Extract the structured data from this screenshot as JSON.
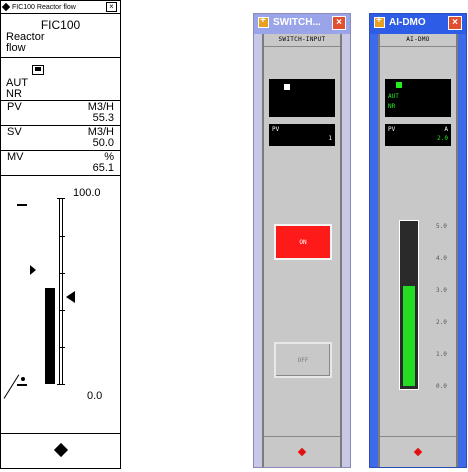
{
  "faceplate": {
    "title": "FIC100 Reactor flow",
    "close_glyph": "×",
    "tag": "FIC100",
    "comment_line1": "Reactor",
    "comment_line2": "flow",
    "mode": "AUT",
    "status": "NR",
    "pv": {
      "label": "PV",
      "unit": "M3/H",
      "value": "55.3"
    },
    "sv": {
      "label": "SV",
      "unit": "M3/H",
      "value": "50.0"
    },
    "mv": {
      "label": "MV",
      "unit": "%",
      "value": "65.1"
    },
    "scale_high": "100.0",
    "scale_low": "0.0"
  },
  "switch_window": {
    "title": "SWITCH...",
    "close_glyph": "×",
    "header": "SWITCH-INPUT",
    "pv_label": "PV",
    "pv_value": "1",
    "on_label": "ON",
    "off_label": "OFF",
    "colors": {
      "on": "#ff1a1a",
      "indicator": "#ffffff"
    }
  },
  "ai_window": {
    "title": "AI-DMO",
    "close_glyph": "×",
    "header": "AI-DMO",
    "mode": "AUT",
    "status": "NR",
    "pv_label": "PV",
    "pv_unit": "A",
    "pv_value": "2.0",
    "scale_ticks": [
      "5.0",
      "4.0",
      "3.0",
      "2.0",
      "1.0",
      "0.0"
    ],
    "bar_level": 0.62,
    "colors": {
      "bar": "#22dd22",
      "led": "#22ee22"
    }
  }
}
